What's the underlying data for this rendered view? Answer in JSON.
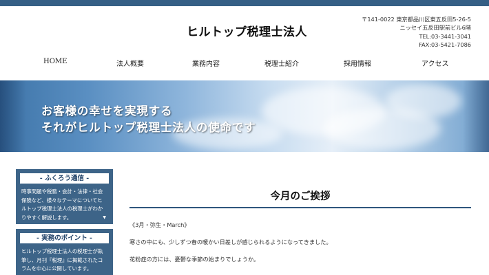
{
  "site": {
    "title": "ヒルトップ税理士法人"
  },
  "contact": {
    "postal": "〒141-0022 東京都品川区東五反田5-26-5",
    "building": "ニッセイ五反田駅前ビル6階",
    "tel": "TEL:03-3441-3041",
    "fax": "FAX:03-5421-7086"
  },
  "nav": {
    "items": [
      {
        "label": "HOME"
      },
      {
        "label": "法人概要"
      },
      {
        "label": "業務内容"
      },
      {
        "label": "税理士紹介"
      },
      {
        "label": "採用情報"
      },
      {
        "label": "アクセス"
      }
    ]
  },
  "hero": {
    "line1": "お客様の幸せを実現する",
    "line2": "それがヒルトップ税理士法人の使命です"
  },
  "sidebar": {
    "boxes": [
      {
        "heading": "- ふくろう通信 -",
        "text": "時事問題や税務・会計・法律・社会保険など、様々なテーマについてヒルトップ税理士法人の税理士がわかりやすく解説します。"
      },
      {
        "heading": "- 実務のポイント -",
        "text": "ヒルトップ税理士法人の税理士が執筆し、月刊『税理』に掲載されたコラムを中心に公開しています。"
      }
    ],
    "arrow_icon": "triangle-down-icon"
  },
  "main": {
    "title": "今月のご挨拶",
    "paragraphs": [
      "《3月・弥生・March》",
      "寒さの中にも、少しずつ春の暖かい日差しが感じられるようになってきました。",
      "花粉症の方には、憂鬱な季節の始まりでしょうか。"
    ]
  },
  "colors": {
    "topbar": "#355f85",
    "sidebar": "#3d6488",
    "rule": "#2f557d"
  }
}
